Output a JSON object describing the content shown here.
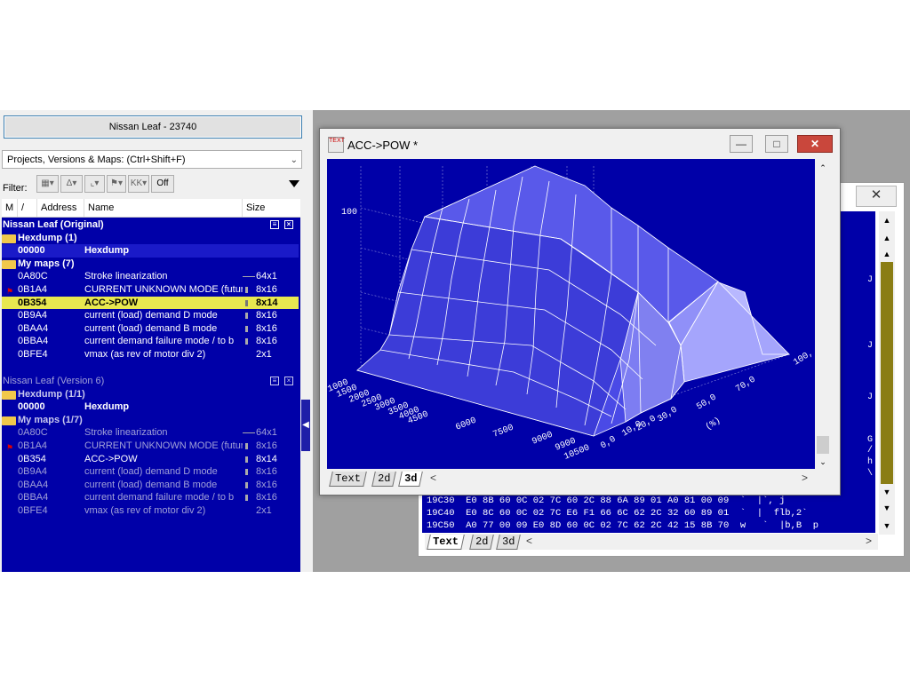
{
  "left_panel": {
    "project_title": "Nissan Leaf - 23740",
    "dropdown_label": "Projects, Versions & Maps:  (Ctrl+Shift+F)",
    "filter_label": "Filter:",
    "filter_off_label": "Off",
    "columns": {
      "m": "M",
      "sort": "/",
      "address": "Address",
      "name": "Name",
      "size": "Size"
    },
    "original": {
      "title": "Nissan Leaf (Original)",
      "hexdump_group": "Hexdump (1)",
      "hexdump_row": {
        "address": "00000",
        "name": "Hexdump"
      },
      "maps_group": "My maps (7)",
      "maps": [
        {
          "address": "0A80C",
          "name": "Stroke linearization",
          "size": "64x1"
        },
        {
          "address": "0B1A4",
          "name": "CURRENT UNKNOWN MODE (future",
          "size": "8x16"
        },
        {
          "address": "0B354",
          "name": "ACC->POW",
          "size": "8x14"
        },
        {
          "address": "0B9A4",
          "name": "current (load) demand D mode",
          "size": "8x16"
        },
        {
          "address": "0BAA4",
          "name": "current (load) demand B mode",
          "size": "8x16"
        },
        {
          "address": "0BBA4",
          "name": "current demand failure mode / to b",
          "size": "8x16"
        },
        {
          "address": "0BFE4",
          "name": "vmax (as rev of motor div 2)",
          "size": "2x1"
        }
      ]
    },
    "version6": {
      "title": "Nissan Leaf (Version 6)",
      "hexdump_group": "Hexdump (1/1)",
      "hexdump_row": {
        "address": "00000",
        "name": "Hexdump"
      },
      "maps_group": "My maps (1/7)",
      "maps": [
        {
          "address": "0A80C",
          "name": "Stroke linearization",
          "size": "64x1"
        },
        {
          "address": "0B1A4",
          "name": "CURRENT UNKNOWN MODE (future",
          "size": "8x16"
        },
        {
          "address": "0B354",
          "name": "ACC->POW",
          "size": "8x14"
        },
        {
          "address": "0B9A4",
          "name": "current (load) demand D mode",
          "size": "8x16"
        },
        {
          "address": "0BAA4",
          "name": "current (load) demand B mode",
          "size": "8x16"
        },
        {
          "address": "0BBA4",
          "name": "current demand failure mode / to b",
          "size": "8x16"
        },
        {
          "address": "0BFE4",
          "name": "vmax (as rev of motor div 2)",
          "size": "2x1"
        }
      ]
    }
  },
  "front_window": {
    "title": "ACC->POW *",
    "tabs": [
      "Text",
      "2d",
      "3d"
    ],
    "active_tab": "3d",
    "z_tick": "100",
    "rpm_ticks": [
      "1000",
      "1500",
      "2000",
      "2500",
      "3000",
      "3500",
      "4000",
      "4500",
      "6000",
      "7500",
      "9000",
      "9900",
      "10500"
    ],
    "pct_ticks": [
      "0,0",
      "10,0",
      "20,0",
      "30,0",
      "50,0",
      "70,0",
      "100,"
    ],
    "pct_axis_label": "(%)"
  },
  "back_window": {
    "tabs": [
      "Text",
      "2d",
      "3d"
    ],
    "active_tab": "Text",
    "hex_rows": [
      {
        "addr": "19C30",
        "bytes": "E0 8B 60 0C 02 7C 60 2C 88 6A 89 01 A0 81 00 09",
        "ascii": "`  |`, j"
      },
      {
        "addr": "19C40",
        "bytes": "E0 8C 60 0C 02 7C E6 F1 66 6C 62 2C 32 60 89 01",
        "ascii": "`  |  flb,2`"
      },
      {
        "addr": "19C50",
        "bytes": "A0 77 00 09 E0 8D 60 0C 02 7C 62 2C 42 15 8B 70",
        "ascii": "w   `  |b,B  p"
      }
    ],
    "side_chars": [
      "J",
      "J",
      "J",
      "G",
      "/",
      "h",
      "\\"
    ]
  }
}
